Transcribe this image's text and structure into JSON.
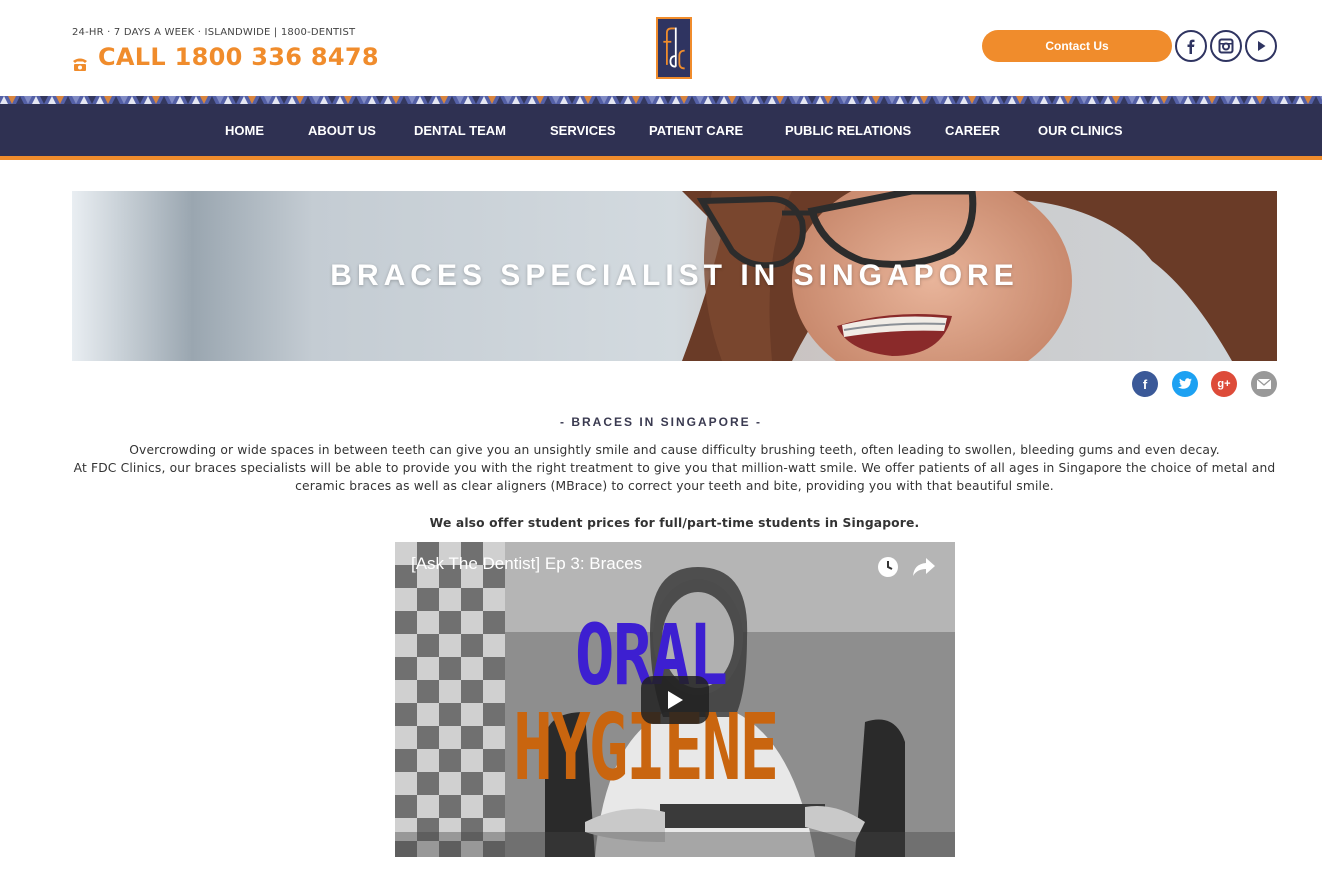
{
  "header": {
    "tagline": "24-HR · 7 DAYS A WEEK · ISLANDWIDE | 1800-DENTIST",
    "call": "CALL 1800 336 8478",
    "contact_label": "Contact Us",
    "logo_text": "fdc"
  },
  "nav": {
    "items": [
      {
        "label": "HOME"
      },
      {
        "label": "ABOUT US"
      },
      {
        "label": "DENTAL TEAM"
      },
      {
        "label": "SERVICES"
      },
      {
        "label": "PATIENT CARE"
      },
      {
        "label": "PUBLIC RELATIONS"
      },
      {
        "label": "CAREER"
      },
      {
        "label": "OUR CLINICS"
      }
    ]
  },
  "hero": {
    "title": "BRACES SPECIALIST IN SINGAPORE"
  },
  "share": {
    "icons": [
      "facebook-icon",
      "twitter-icon",
      "google-plus-icon",
      "email-icon"
    ]
  },
  "content": {
    "section_title": "- BRACES IN SINGAPORE -",
    "paragraph1": "Overcrowding or wide spaces in between teeth can give you an unsightly smile and cause difficulty brushing teeth, often leading to swollen, bleeding gums and even decay.",
    "paragraph2": "At FDC Clinics, our braces specialists will be able to provide you with the right treatment to give you that million-watt smile. We offer patients of all ages in Singapore the choice of metal and ceramic braces as well as clear aligners (MBrace) to correct your teeth and bite, providing you with that beautiful smile.",
    "student_note": "We also offer student prices for full/part-time students in Singapore."
  },
  "video": {
    "title": "[Ask The Dentist] Ep 3: Braces",
    "overlay_line1": "ORAL",
    "overlay_line2": "HYGIENE"
  },
  "colors": {
    "accent": "#f08c2c",
    "navy": "#2f3152",
    "facebook": "#3b5998",
    "twitter": "#1da1f2",
    "google": "#dd4b39",
    "email": "#999999"
  }
}
